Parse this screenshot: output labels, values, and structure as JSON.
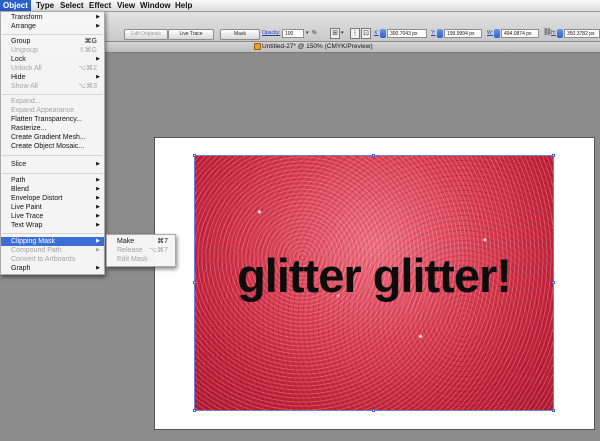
{
  "menubar": {
    "items": [
      "Object",
      "Type",
      "Select",
      "Effect",
      "View",
      "Window",
      "Help"
    ]
  },
  "controlbar": {
    "edit_originals": "Edit Originals",
    "live_trace": "Live Trace",
    "mask": "Mask",
    "opacity_label": "Opacity:",
    "opacity_value": "100",
    "percent": "%",
    "x_label": "X:",
    "x_value": "300.7043 px",
    "y_label": "Y:",
    "y_value": "199.9994 px",
    "w_label": "W:",
    "w_value": "494.0874 px",
    "h_label": "H:",
    "h_value": "350.3782 px"
  },
  "document": {
    "title": "Untitled-27* @ 150% (CMYK/Preview)",
    "artwork_text": "glitter glitter!"
  },
  "object_menu": {
    "items": [
      {
        "label": "Transform",
        "submenu": true
      },
      {
        "label": "Arrange",
        "submenu": true
      },
      {
        "label": "Group",
        "shortcut": "⌘G"
      },
      {
        "label": "Ungroup",
        "shortcut": "⇧⌘G",
        "disabled": true
      },
      {
        "label": "Lock",
        "submenu": true
      },
      {
        "label": "Unlock All",
        "shortcut": "⌥⌘2",
        "disabled": true
      },
      {
        "label": "Hide",
        "submenu": true
      },
      {
        "label": "Show All",
        "shortcut": "⌥⌘3",
        "disabled": true
      },
      {
        "label": "Expand...",
        "disabled": true
      },
      {
        "label": "Expand Appearance",
        "disabled": true
      },
      {
        "label": "Flatten Transparency..."
      },
      {
        "label": "Rasterize..."
      },
      {
        "label": "Create Gradient Mesh..."
      },
      {
        "label": "Create Object Mosaic..."
      },
      {
        "label": "Slice",
        "submenu": true
      },
      {
        "label": "Path",
        "submenu": true
      },
      {
        "label": "Blend",
        "submenu": true
      },
      {
        "label": "Envelope Distort",
        "submenu": true
      },
      {
        "label": "Live Paint",
        "submenu": true
      },
      {
        "label": "Live Trace",
        "submenu": true
      },
      {
        "label": "Text Wrap",
        "submenu": true
      },
      {
        "label": "Clipping Mask",
        "submenu": true,
        "highlighted": true
      },
      {
        "label": "Compound Path",
        "submenu": true,
        "disabled": true
      },
      {
        "label": "Convert to Artboards",
        "disabled": true
      },
      {
        "label": "Graph",
        "submenu": true
      }
    ]
  },
  "clipping_submenu": {
    "items": [
      {
        "label": "Make",
        "shortcut": "⌘7"
      },
      {
        "label": "Release",
        "shortcut": "⌥⌘7",
        "disabled": true
      },
      {
        "label": "Edit Mask",
        "disabled": true
      }
    ]
  },
  "icons": {
    "submenu_arrow": "▶",
    "doc_icon": "illustrator-doc-icon"
  }
}
